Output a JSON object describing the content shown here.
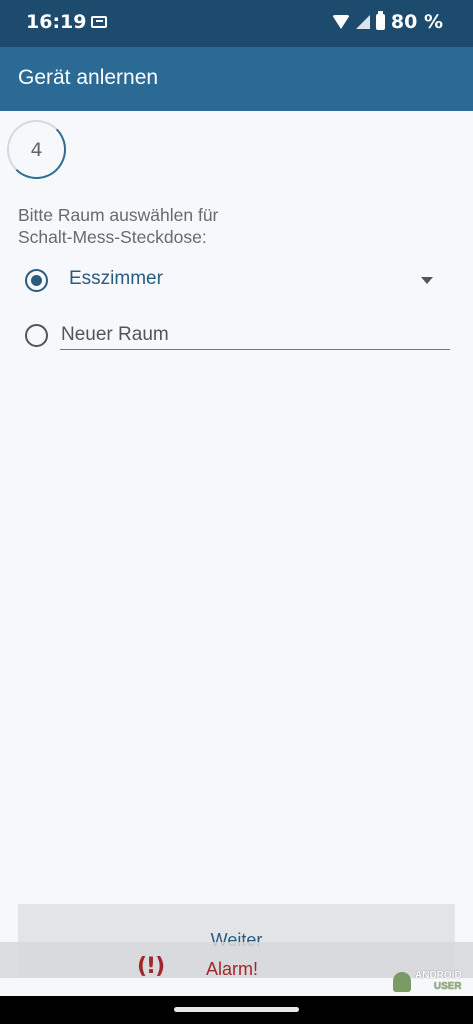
{
  "status_bar": {
    "time": "16:19",
    "battery_text": "80 %"
  },
  "app_bar": {
    "title": "Gerät anlernen"
  },
  "step": {
    "number": "4"
  },
  "prompt": {
    "line1": "Bitte Raum auswählen für",
    "line2": "Schalt-Mess-Steckdose:"
  },
  "room_options": {
    "selected_room": "Esszimmer",
    "new_room_placeholder": "Neuer Raum"
  },
  "footer": {
    "next_label": "Weiter",
    "alarm_icon": "(!)",
    "alarm_label": "Alarm!"
  },
  "watermark": {
    "line1": "ANDROID",
    "line2": "USER"
  },
  "colors": {
    "status_bar": "#1d4b6e",
    "app_bar": "#2a6a95",
    "accent": "#2b5c80",
    "alarm": "#a3262a"
  }
}
